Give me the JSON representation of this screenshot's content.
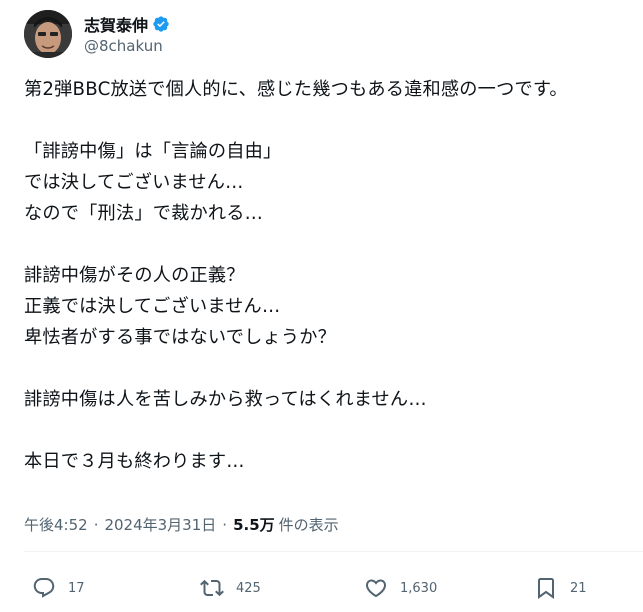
{
  "author": {
    "display_name": "志賀泰伸",
    "handle": "@8chakun",
    "verified": true,
    "avatar_icon": "profile-photo",
    "verified_icon": "verified-badge-icon",
    "verified_color": "#1d9bf0"
  },
  "tweet": {
    "text": "第2弾BBC放送で個人的に、感じた幾つもある違和感の一つです。\n\n「誹謗中傷」は「言論の自由」\nでは決してございません…\nなので「刑法」で裁かれる…\n\n誹謗中傷がその人の正義？\n正義では決してございません…\n卑怯者がする事ではないでしょうか？\n\n誹謗中傷は人を苦しみから救ってはくれません…\n\n本日で３月も終わります…"
  },
  "meta": {
    "time": "午後4:52",
    "separator": "·",
    "date": "2024年3月31日",
    "views_count": "5.5万",
    "views_label": "件の表示"
  },
  "actions": {
    "reply": {
      "icon": "reply-icon",
      "count": "17"
    },
    "retweet": {
      "icon": "retweet-icon",
      "count": "425"
    },
    "like": {
      "icon": "heart-icon",
      "count": "1,630"
    },
    "bookmark": {
      "icon": "bookmark-icon",
      "count": "21"
    }
  },
  "colors": {
    "text_primary": "#0f1419",
    "text_secondary": "#536471",
    "divider": "#eff3f4"
  }
}
